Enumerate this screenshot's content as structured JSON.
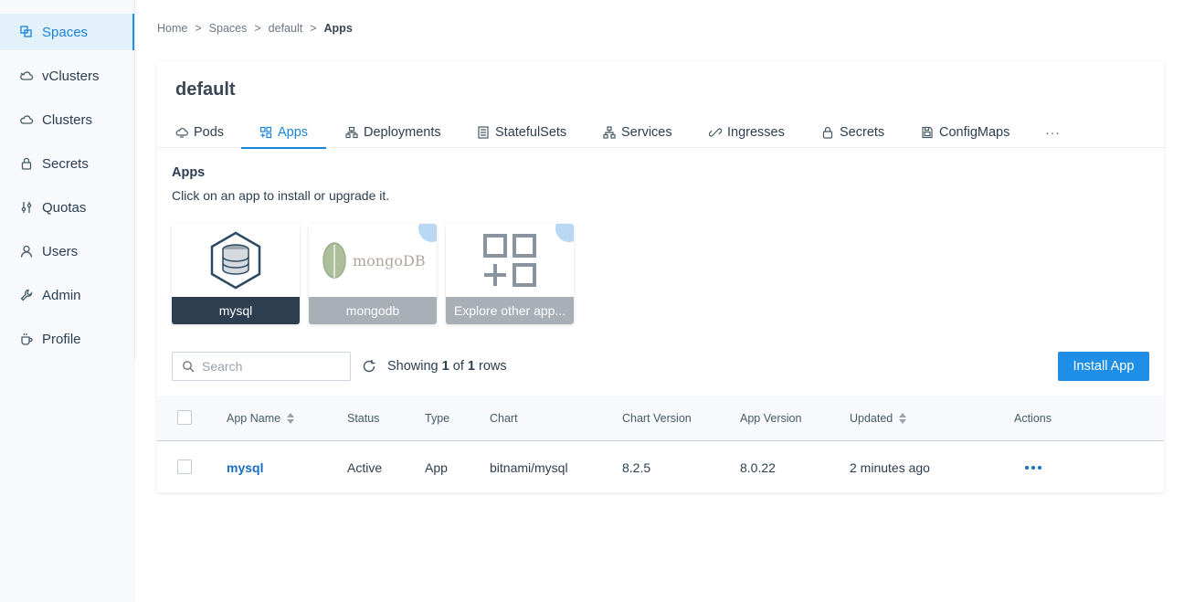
{
  "sidebar": {
    "items": [
      {
        "label": "Spaces",
        "icon": "spaces-icon",
        "active": true
      },
      {
        "label": "vClusters",
        "icon": "cloud-icon"
      },
      {
        "label": "Clusters",
        "icon": "cloud-outline-icon"
      },
      {
        "label": "Secrets",
        "icon": "lock-icon"
      },
      {
        "label": "Quotas",
        "icon": "sliders-icon"
      },
      {
        "label": "Users",
        "icon": "user-icon"
      },
      {
        "label": "Admin",
        "icon": "wrench-icon"
      },
      {
        "label": "Profile",
        "icon": "coffee-icon"
      }
    ],
    "accent": "#1f8ee6"
  },
  "breadcrumb": {
    "items": [
      "Home",
      "Spaces",
      "default"
    ],
    "separator": ">",
    "current": "Apps"
  },
  "page": {
    "title": "default"
  },
  "tabs": [
    {
      "label": "Pods",
      "icon": "pods-icon"
    },
    {
      "label": "Apps",
      "icon": "apps-icon",
      "active": true
    },
    {
      "label": "Deployments",
      "icon": "deployments-icon"
    },
    {
      "label": "StatefulSets",
      "icon": "statefulsets-icon"
    },
    {
      "label": "Services",
      "icon": "services-icon"
    },
    {
      "label": "Ingresses",
      "icon": "ingresses-icon"
    },
    {
      "label": "Secrets",
      "icon": "lock-icon"
    },
    {
      "label": "ConfigMaps",
      "icon": "configmaps-icon"
    }
  ],
  "tabs_more": "···",
  "apps_section": {
    "title": "Apps",
    "subtitle": "Click on an app to install or upgrade it.",
    "tiles": [
      {
        "label": "mysql",
        "logo": "mysql-database-icon",
        "selected": true
      },
      {
        "label": "mongodb",
        "logo": "mongodb-logo",
        "logo_text": "mongoDB"
      },
      {
        "label": "Explore other app...",
        "logo": "explore-apps-icon"
      }
    ]
  },
  "toolbar": {
    "search_placeholder": "Search",
    "showing_prefix": "Showing",
    "showing_from": "1",
    "showing_of": "of",
    "showing_total": "1",
    "showing_suffix": "rows",
    "install_label": "Install App",
    "install_color": "#1f8ee6"
  },
  "table": {
    "headers": {
      "app_name": "App Name",
      "status": "Status",
      "type": "Type",
      "chart": "Chart",
      "chart_version": "Chart Version",
      "app_version": "App Version",
      "updated": "Updated",
      "actions": "Actions"
    },
    "rows": [
      {
        "app_name": "mysql",
        "status": "Active",
        "type": "App",
        "chart": "bitnami/mysql",
        "chart_version": "8.2.5",
        "app_version": "8.0.22",
        "updated": "2 minutes ago"
      }
    ]
  }
}
